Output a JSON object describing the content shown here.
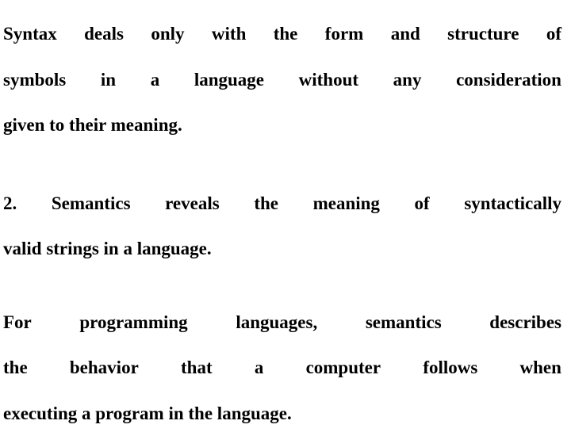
{
  "slide": {
    "background_color": "#ffffff",
    "text_color": "#000000",
    "blocks": [
      {
        "id": "block-syntax",
        "lines": [
          {
            "words": [
              "Syntax",
              "deals",
              "only",
              "with",
              "the",
              "form",
              "and",
              "structure",
              "of"
            ],
            "justified": true
          },
          {
            "words": [
              "symbols",
              "in",
              "a",
              "language",
              "without",
              "any",
              "consideration"
            ],
            "justified": true
          },
          {
            "words": [
              "given",
              "to",
              "their",
              "meaning."
            ],
            "justified": false
          }
        ],
        "text": "Syntax deals only with the form and structure of symbols in a language without any consideration given to their meaning."
      },
      {
        "id": "block-semantics",
        "lines": [
          {
            "words": [
              "2.",
              "Semantics",
              "reveals",
              "the",
              "meaning",
              "of",
              "syntactically"
            ],
            "justified": true
          },
          {
            "words": [
              "valid",
              "strings",
              "in",
              "a",
              "language."
            ],
            "justified": false
          }
        ],
        "text": "2. Semantics reveals the meaning of syntactically valid strings in a language."
      },
      {
        "id": "block-programming",
        "lines": [
          {
            "words": [
              "For",
              "programming",
              "languages,",
              "semantics",
              "describes"
            ],
            "justified": true
          },
          {
            "words": [
              "the",
              "behavior",
              "that",
              "a",
              "computer",
              "follows",
              "when"
            ],
            "justified": true
          },
          {
            "words": [
              "executing",
              "a",
              "program",
              "in",
              "the",
              "language."
            ],
            "justified": false
          }
        ],
        "text": "For programming languages, semantics describes the behavior that a computer follows when executing a program in the language."
      }
    ]
  }
}
